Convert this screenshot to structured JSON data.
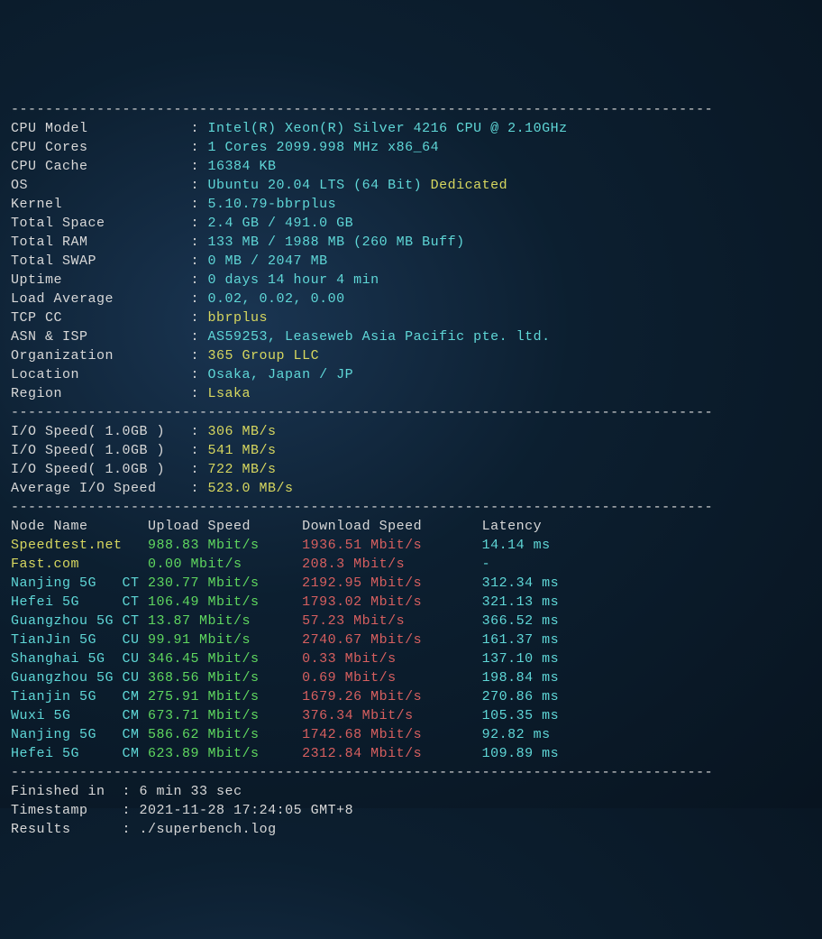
{
  "divider": "----------------------------------------------------------------------------------",
  "sys": {
    "cpu_model": {
      "label": "CPU Model            ",
      "value": "Intel(R) Xeon(R) Silver 4216 CPU @ 2.10GHz"
    },
    "cpu_cores": {
      "label": "CPU Cores            ",
      "value": "1 Cores 2099.998 MHz x86_64"
    },
    "cpu_cache": {
      "label": "CPU Cache            ",
      "value": "16384 KB"
    },
    "os": {
      "label": "OS                   ",
      "value": "Ubuntu 20.04 LTS (64 Bit)",
      "extra": "Dedicated"
    },
    "kernel": {
      "label": "Kernel               ",
      "value": "5.10.79-bbrplus"
    },
    "total_space": {
      "label": "Total Space          ",
      "value": "2.4 GB / 491.0 GB"
    },
    "total_ram": {
      "label": "Total RAM            ",
      "value": "133 MB / 1988 MB (260 MB Buff)"
    },
    "total_swap": {
      "label": "Total SWAP           ",
      "value": "0 MB / 2047 MB"
    },
    "uptime": {
      "label": "Uptime               ",
      "value": "0 days 14 hour 4 min"
    },
    "load_avg": {
      "label": "Load Average         ",
      "value": "0.02, 0.02, 0.00"
    },
    "tcp_cc": {
      "label": "TCP CC               ",
      "value": "bbrplus"
    },
    "asn_isp": {
      "label": "ASN & ISP            ",
      "value": "AS59253, Leaseweb Asia Pacific pte. ltd."
    },
    "org": {
      "label": "Organization         ",
      "value": "365 Group LLC"
    },
    "location": {
      "label": "Location             ",
      "value": "Osaka, Japan / JP"
    },
    "region": {
      "label": "Region               ",
      "value": "Lsaka"
    }
  },
  "io": {
    "test1": {
      "label": "I/O Speed( 1.0GB )   ",
      "value": "306 MB/s"
    },
    "test2": {
      "label": "I/O Speed( 1.0GB )   ",
      "value": "541 MB/s"
    },
    "test3": {
      "label": "I/O Speed( 1.0GB )   ",
      "value": "722 MB/s"
    },
    "avg": {
      "label": "Average I/O Speed    ",
      "value": "523.0 MB/s"
    }
  },
  "speedtest": {
    "header": {
      "node": "Node Name       ",
      "upload": "Upload Speed      ",
      "download": "Download Speed       ",
      "latency": "Latency"
    },
    "rows": [
      {
        "node": "Speedtest.net   ",
        "upload": "988.83 Mbit/s     ",
        "download": "1936.51 Mbit/s       ",
        "latency": "14.14 ms",
        "node_color": "yellow"
      },
      {
        "node": "Fast.com        ",
        "upload": "0.00 Mbit/s       ",
        "download": "208.3 Mbit/s         ",
        "latency": "-",
        "node_color": "yellow"
      },
      {
        "node": "Nanjing 5G   CT ",
        "upload": "230.77 Mbit/s     ",
        "download": "2192.95 Mbit/s       ",
        "latency": "312.34 ms",
        "node_color": "cyan"
      },
      {
        "node": "Hefei 5G     CT ",
        "upload": "106.49 Mbit/s     ",
        "download": "1793.02 Mbit/s       ",
        "latency": "321.13 ms",
        "node_color": "cyan"
      },
      {
        "node": "Guangzhou 5G CT ",
        "upload": "13.87 Mbit/s      ",
        "download": "57.23 Mbit/s         ",
        "latency": "366.52 ms",
        "node_color": "cyan"
      },
      {
        "node": "TianJin 5G   CU ",
        "upload": "99.91 Mbit/s      ",
        "download": "2740.67 Mbit/s       ",
        "latency": "161.37 ms",
        "node_color": "cyan"
      },
      {
        "node": "Shanghai 5G  CU ",
        "upload": "346.45 Mbit/s     ",
        "download": "0.33 Mbit/s          ",
        "latency": "137.10 ms",
        "node_color": "cyan"
      },
      {
        "node": "Guangzhou 5G CU ",
        "upload": "368.56 Mbit/s     ",
        "download": "0.69 Mbit/s          ",
        "latency": "198.84 ms",
        "node_color": "cyan"
      },
      {
        "node": "Tianjin 5G   CM ",
        "upload": "275.91 Mbit/s     ",
        "download": "1679.26 Mbit/s       ",
        "latency": "270.86 ms",
        "node_color": "cyan"
      },
      {
        "node": "Wuxi 5G      CM ",
        "upload": "673.71 Mbit/s     ",
        "download": "376.34 Mbit/s        ",
        "latency": "105.35 ms",
        "node_color": "cyan"
      },
      {
        "node": "Nanjing 5G   CM ",
        "upload": "586.62 Mbit/s     ",
        "download": "1742.68 Mbit/s       ",
        "latency": "92.82 ms",
        "node_color": "cyan"
      },
      {
        "node": "Hefei 5G     CM ",
        "upload": "623.89 Mbit/s     ",
        "download": "2312.84 Mbit/s       ",
        "latency": "109.89 ms",
        "node_color": "cyan"
      }
    ]
  },
  "footer": {
    "finished": {
      "label": "Finished in  ",
      "value": "6 min 33 sec"
    },
    "timestamp": {
      "label": "Timestamp    ",
      "value": "2021-11-28 17:24:05 GMT+8"
    },
    "results": {
      "label": "Results      ",
      "value": "./superbench.log"
    }
  }
}
